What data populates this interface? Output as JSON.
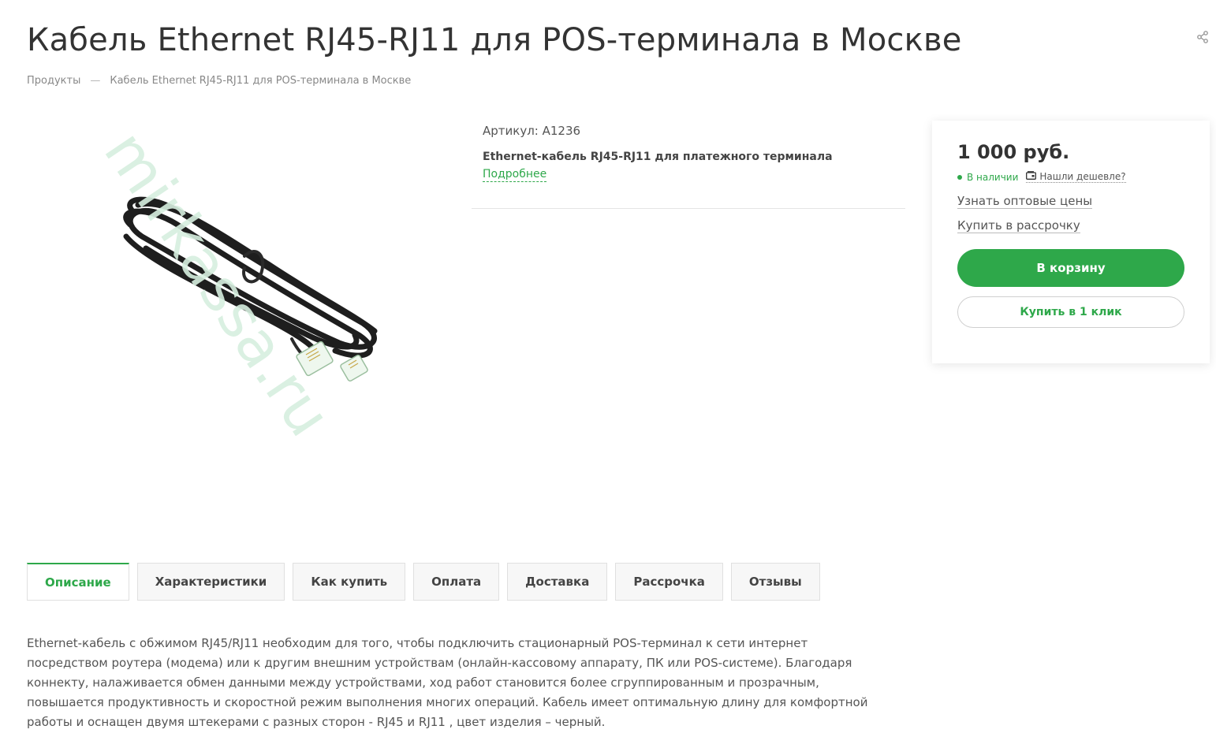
{
  "page": {
    "title": "Кабель Ethernet RJ45-RJ11 для POS-терминала в Москве"
  },
  "breadcrumb": {
    "items": [
      "Продукты",
      "Кабель Ethernet RJ45-RJ11 для POS-терминала в Москве"
    ],
    "separator": "—"
  },
  "product": {
    "article": "Артикул: A1236",
    "short_description": "Ethernet-кабель RJ45-RJ11 для платежного терминала",
    "more_link": "Подробнее",
    "image_watermark": "mirkassa.ru"
  },
  "buy_box": {
    "price": "1 000 руб.",
    "stock": "В наличии",
    "found_cheaper": "Нашли дешевле?",
    "wholesale_link": "Узнать оптовые цены",
    "installment_link": "Купить в рассрочку",
    "cart_button": "В корзину",
    "one_click_button": "Купить в 1 клик"
  },
  "tabs": [
    {
      "label": "Описание",
      "active": true
    },
    {
      "label": "Характеристики",
      "active": false
    },
    {
      "label": "Как купить",
      "active": false
    },
    {
      "label": "Оплата",
      "active": false
    },
    {
      "label": "Доставка",
      "active": false
    },
    {
      "label": "Рассрочка",
      "active": false
    },
    {
      "label": "Отзывы",
      "active": false
    }
  ],
  "description": "Ethernet-кабель с обжимом RJ45/RJ11 необходим для того, чтобы подключить стационарный POS-терминал к сети интернет посредством роутера (модема) или к другим внешним устройствам (онлайн-кассовому аппарату, ПК или POS-системе). Благодаря коннекту, налаживается обмен данными между устройствами, ход работ становится более сгруппированным и прозрачным, повышается продуктивность и скоростной режим выполнения многих операций. Кабель имеет оптимальную длину для комфортной работы и оснащен двумя штекерами с разных сторон - RJ45 и RJ11 , цвет изделия – черный.",
  "colors": {
    "accent": "#2ea84a",
    "text": "#333333",
    "muted": "#888888",
    "watermark": "#d7efdf"
  },
  "icons": {
    "share": "share-icon",
    "stock": "stock-dot-icon",
    "cheaper": "wallet-icon"
  }
}
